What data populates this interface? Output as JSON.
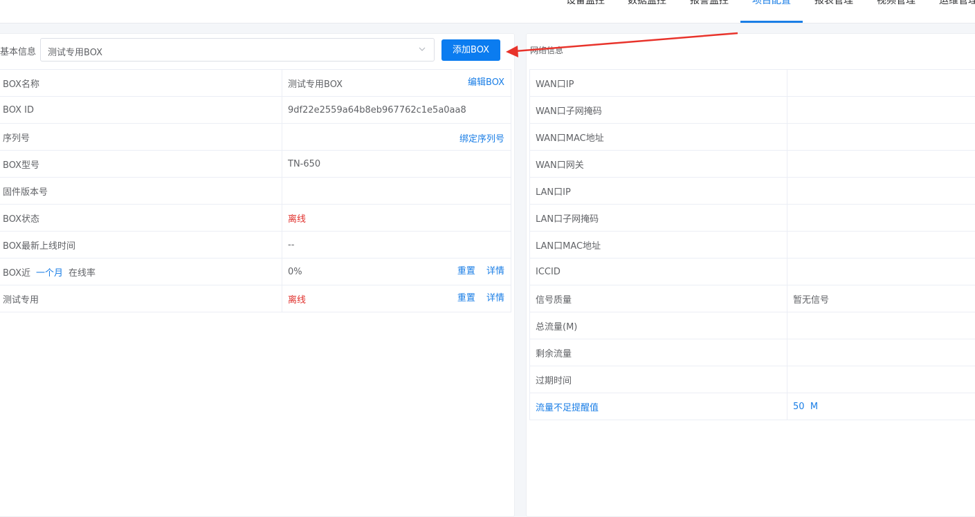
{
  "nav": {
    "items": [
      {
        "label": "设备监控"
      },
      {
        "label": "数据监控"
      },
      {
        "label": "报警监控"
      },
      {
        "label": "项目配置"
      },
      {
        "label": "报表管理"
      },
      {
        "label": "视频管理"
      },
      {
        "label": "运维管理"
      }
    ],
    "active_index": 3,
    "accent_color": "#1a7ee6"
  },
  "basic": {
    "label": "基本信息",
    "select_value": "测试专用BOX",
    "add_button_label": "添加BOX"
  },
  "left_table": {
    "rows": [
      {
        "label": "BOX名称",
        "value": "测试专用BOX",
        "action": "编辑BOX"
      },
      {
        "label": "BOX ID",
        "value": "9df22e2559a64b8eb967762c1e5a0aa8"
      },
      {
        "label": "序列号",
        "value": "",
        "action": "绑定序列号"
      },
      {
        "label": "BOX型号",
        "value": "TN-650"
      },
      {
        "label": "固件版本号",
        "value": ""
      },
      {
        "label": "BOX状态",
        "value": "离线"
      },
      {
        "label": "BOX最新上线时间",
        "value": "--"
      },
      {
        "label_prefix": "BOX近",
        "period": "一个月",
        "label_suffix": "在线率",
        "value": "0%",
        "action_reset": "重置",
        "action_detail": "详情"
      },
      {
        "label": "测试专用",
        "value": "离线",
        "action_reset": "重置",
        "action_detail": "详情"
      }
    ]
  },
  "network": {
    "title": "网络信息",
    "rows": [
      {
        "label": "WAN口IP",
        "value": ""
      },
      {
        "label": "WAN口子网掩码",
        "value": ""
      },
      {
        "label": "WAN口MAC地址",
        "value": ""
      },
      {
        "label": "WAN口网关",
        "value": ""
      },
      {
        "label": "LAN口IP",
        "value": ""
      },
      {
        "label": "LAN口子网掩码",
        "value": ""
      },
      {
        "label": "LAN口MAC地址",
        "value": ""
      },
      {
        "label": "ICCID",
        "value": ""
      },
      {
        "label": "信号质量",
        "value": "暂无信号"
      },
      {
        "label": "总流量(M)",
        "value": ""
      },
      {
        "label": "剩余流量",
        "value": ""
      },
      {
        "label": "过期时间",
        "value": ""
      },
      {
        "label": "流量不足提醒值",
        "value": "50",
        "unit": "M"
      }
    ]
  },
  "colors": {
    "primary_button": "#0b7cf0",
    "offline_status": "#e0312d",
    "annotation_arrow": "#e8332b"
  }
}
